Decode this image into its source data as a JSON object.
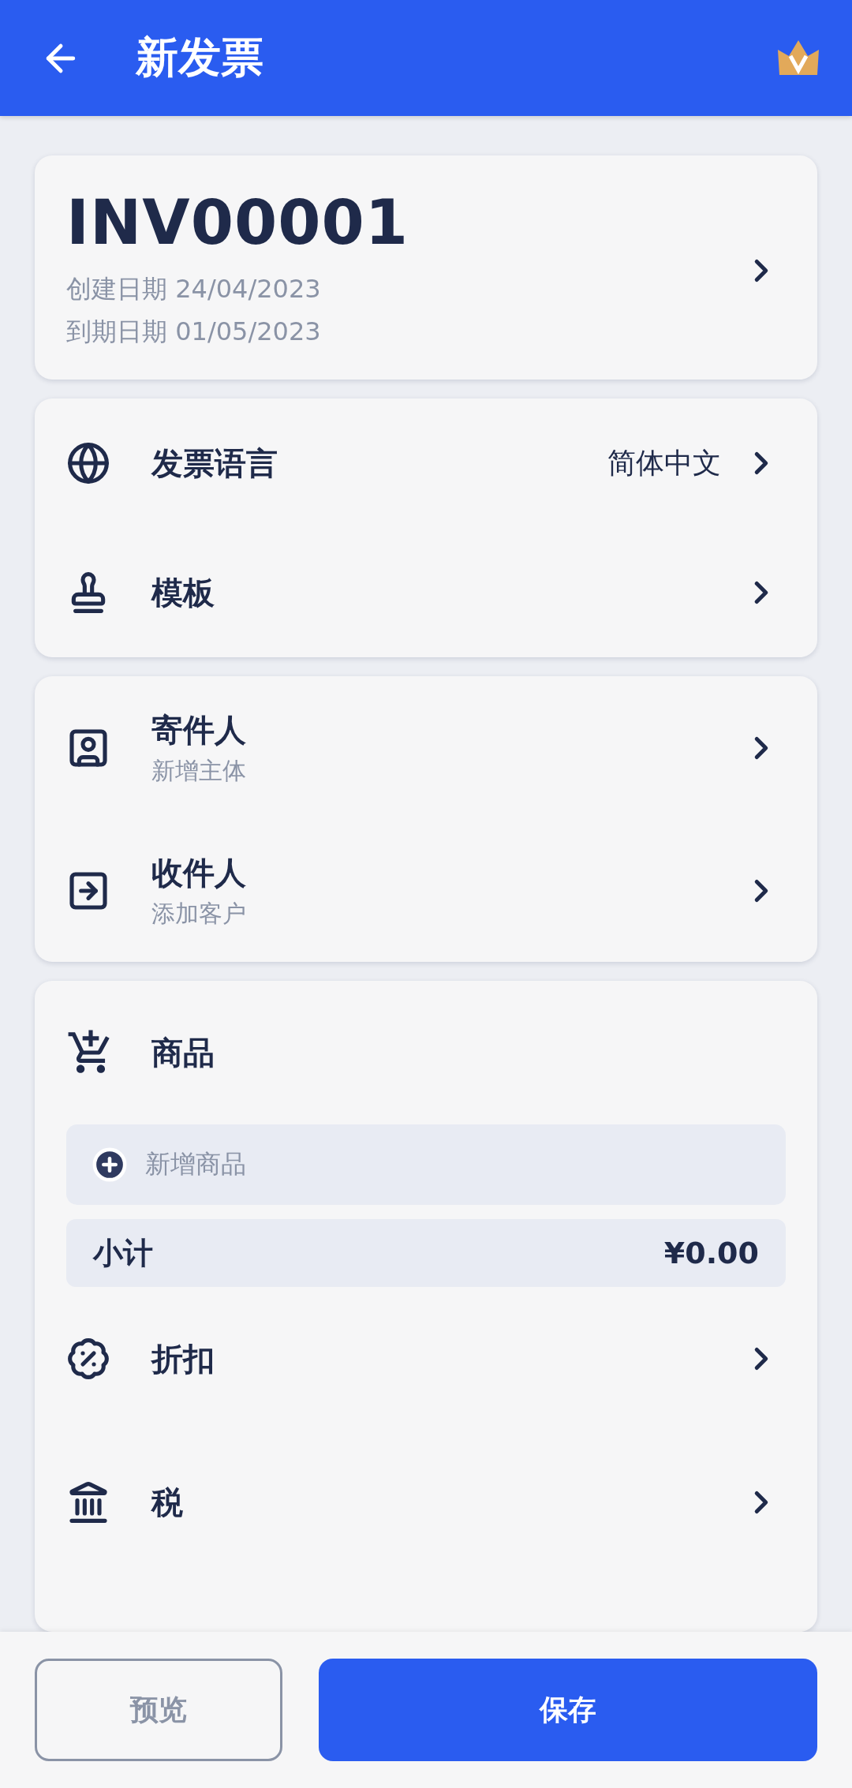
{
  "header": {
    "title": "新发票"
  },
  "invoice": {
    "number": "INV00001",
    "dates": [
      "创建日期 24/04/2023",
      "到期日期 01/05/2023"
    ]
  },
  "settings": [
    {
      "label": "发票语言",
      "value": "简体中文"
    },
    {
      "label": "模板"
    }
  ],
  "parties": [
    {
      "label": "寄件人",
      "sub": "新增主体"
    },
    {
      "label": "收件人",
      "sub": "添加客户"
    }
  ],
  "items_section": {
    "title": "商品",
    "add_item": "新增商品",
    "subtotal_label": "小计",
    "subtotal_value": "¥0.00"
  },
  "adjustments": [
    {
      "label": "折扣"
    },
    {
      "label": "税"
    }
  ],
  "buttons": [
    {
      "label": "预览",
      "kind": "secondary"
    },
    {
      "label": "保存",
      "kind": "primary"
    }
  ]
}
